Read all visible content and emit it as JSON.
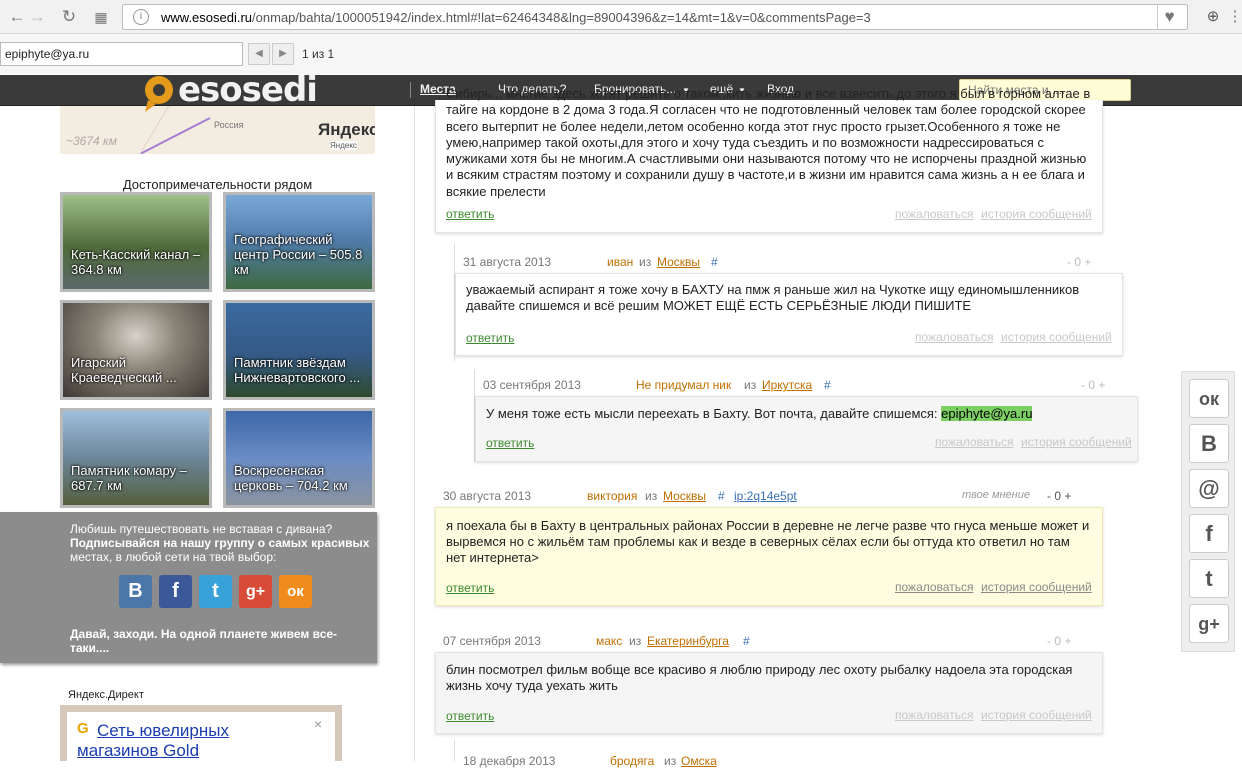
{
  "browser": {
    "url_host": "www.esosedi.ru",
    "url_path": "/onmap/bahta/1000051942/index.html#!lat=62464348&lng=89004396&z=14&mt=1&v=0&commentsPage=3",
    "find_value": "epiphyte@ya.ru",
    "find_count": "1 из 1"
  },
  "site": {
    "logo": "esosedi",
    "menu": [
      "Места",
      "Что делать?",
      "Бронировать...",
      "ещё",
      "Вход"
    ],
    "search_placeholder": "Найти места и ...."
  },
  "map": {
    "distance": "~3674 км",
    "country": "Россия",
    "brand": "Яндекс",
    "brand_small": "Яндекс"
  },
  "sights": {
    "title": "Достопримечательности рядом",
    "tiles": [
      {
        "label": "Кеть-Касский канал – 364.8 км",
        "color": "#4f6b3a"
      },
      {
        "label": "Географический центр России – 505.8 км",
        "color": "#4f7ba8"
      },
      {
        "label": "Игарский Краеведческий ...",
        "color": "#6a6660"
      },
      {
        "label": "Памятник звёздам Нижневартовского ...",
        "color": "#355a86"
      },
      {
        "label": "Памятник комару – 687.7 км",
        "color": "#5a6f80"
      },
      {
        "label": "Воскресенская церковь – 704.2 км",
        "color": "#3d68a8"
      }
    ]
  },
  "social_panel": {
    "line1": "Любишь путешествовать не вставая с дивана?",
    "line2": "Подписывайся на нашу группу о самых красивых",
    "line3": "местах, в любой сети на твой выбор:",
    "footer1": "Давай, заходи. На одной планете живем все-",
    "footer2": "таки....",
    "icons": [
      {
        "name": "vk-icon",
        "glyph": "В",
        "color": "#4a76a8"
      },
      {
        "name": "facebook-icon",
        "glyph": "f",
        "color": "#3b5998"
      },
      {
        "name": "twitter-icon",
        "glyph": "t",
        "color": "#38a1d8"
      },
      {
        "name": "google-plus-icon",
        "glyph": "g+",
        "color": "#d84b37"
      },
      {
        "name": "odnoklassniki-icon",
        "glyph": "ок",
        "color": "#f08b1d"
      }
    ]
  },
  "ad": {
    "label": "Яндекс.Директ",
    "title_line1": "Сеть ювелирных",
    "title_line2": "магазинов Gold",
    "close": "×"
  },
  "comments": [
    {
      "text": "Сибирь... многие здесь хотят решить о таком жить жизнью и все взвесить,до этого я был в горном алтае в тайге на кордоне в 2 дома 3 года.Я согласен что не подготовленный человек там более городской скорее всего вытерпит не более недели,летом особенно когда этот гнус просто грызет.Особенного я тоже не умею,например такой охоты,для этого и хочу туда съездить и по возможности надрессироваться с мужиками хотя бы не многим.А счастливыми они называются потому что не испорчены праздной жизнью и всяким страстям поэтому и сохранили душу в частоте,и в жизни им нравится сама жизнь а н ее блага и всякие прелести",
      "reply": "ответить",
      "complain": "пожаловаться",
      "history": "история сообщений"
    },
    {
      "date": "31 августа 2013",
      "name": "иван",
      "from": "из",
      "city": "Москвы",
      "hash": "#",
      "vote": "- 0 +",
      "text": "уважаемый аспирант я тоже хочу в БАХТУ на пмж я раньше жил на Чукотке ищу единомышленников давайте спишемся и всё решим МОЖЕТ ЕЩЁ ЕСТЬ СЕРЬЁЗНЫЕ ЛЮДИ ПИШИТЕ",
      "reply": "ответить",
      "complain": "пожаловаться",
      "history": "история сообщений"
    },
    {
      "date": "03 сентября 2013",
      "name": "Не придумал ник",
      "from": "из",
      "city": "Иркутска",
      "hash": "#",
      "vote": "- 0 +",
      "text": "У меня тоже есть мысли переехать в Бахту. Вот почта, давайте спишемся:",
      "email": "epiphyte@ya.ru",
      "reply": "ответить",
      "complain": "пожаловаться",
      "history": "история сообщений"
    },
    {
      "date": "30 августа 2013",
      "name": "виктория",
      "from": "из",
      "city": "Москвы",
      "hash": "#",
      "ip": "ip:2q14e5pt",
      "own": "твое мнение",
      "vote": "- 0 +",
      "text": "я поехала бы в Бахту в центральных районах России в деревне не легче разве что гнуса меньше может и вырвемся но с жильём там проблемы как и везде в северных сёлах если бы оттуда кто ответил но там нет интернета>",
      "reply": "ответить",
      "complain": "пожаловаться",
      "history": "история сообщений"
    },
    {
      "date": "07 сентября 2013",
      "name": "макс",
      "from": "из",
      "city": "Екатеринбурга",
      "hash": "#",
      "vote": "- 0 +",
      "text": "блин посмотрел фильм вобще все красиво я люблю природу лес охоту рыбалку надоела эта городская жизнь хочу туда уехать жить",
      "reply": "ответить",
      "complain": "пожаловаться",
      "history": "история сообщений"
    },
    {
      "date": "18 декабря 2013",
      "name": "бродяга",
      "from": "из",
      "city": "Омска"
    }
  ],
  "social_right": [
    {
      "name": "odnoklassniki-share-icon",
      "glyph": "ок"
    },
    {
      "name": "vk-share-icon",
      "glyph": "В"
    },
    {
      "name": "mail-share-icon",
      "glyph": "@"
    },
    {
      "name": "facebook-share-icon",
      "glyph": "f"
    },
    {
      "name": "twitter-share-icon",
      "glyph": "t"
    },
    {
      "name": "google-plus-share-icon",
      "glyph": "g+"
    }
  ]
}
